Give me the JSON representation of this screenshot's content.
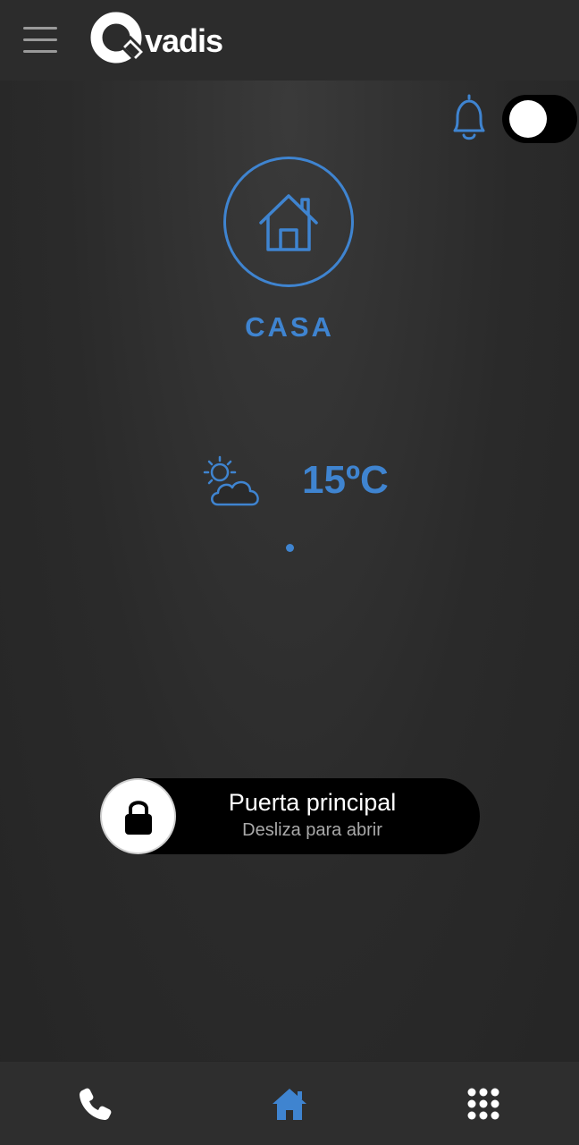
{
  "header": {
    "logo_text": "vadis"
  },
  "location": {
    "label": "CASA"
  },
  "weather": {
    "temperature": "15ºC",
    "icon": "partly-cloudy-icon"
  },
  "slider": {
    "title": "Puerta principal",
    "subtitle": "Desliza para abrir"
  },
  "bottom_nav": {
    "items": [
      {
        "icon": "phone-icon",
        "active": false
      },
      {
        "icon": "home-icon",
        "active": true
      },
      {
        "icon": "keypad-icon",
        "active": false
      }
    ]
  },
  "colors": {
    "accent": "#3f84d0",
    "background": "#2b2b2b",
    "header": "#2c2c2c",
    "toggle_bg": "#000000"
  }
}
